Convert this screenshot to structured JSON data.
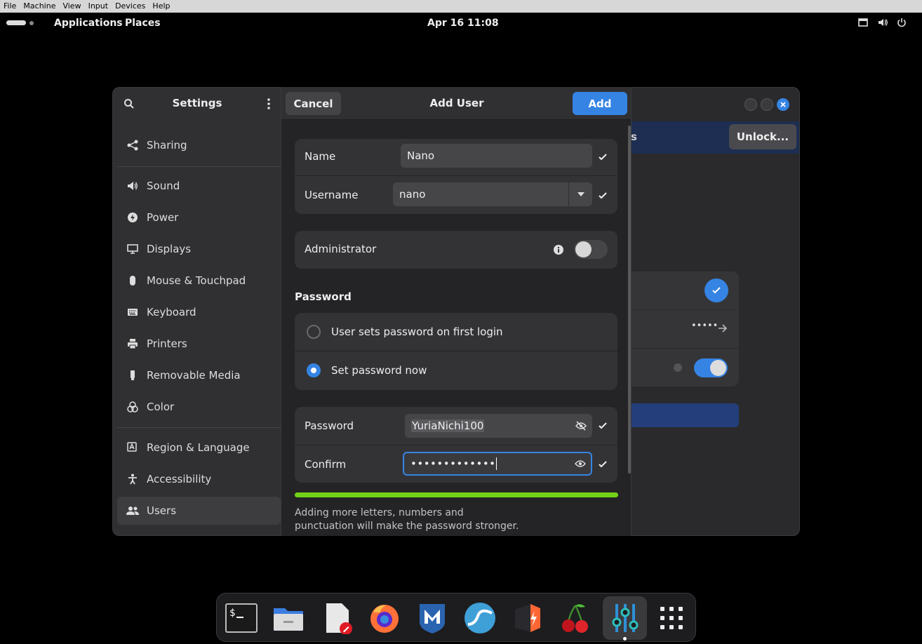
{
  "vm_menu": [
    "File",
    "Machine",
    "View",
    "Input",
    "Devices",
    "Help"
  ],
  "topbar": {
    "applications": "Applications",
    "places": "Places",
    "clock": "Apr 16  11:08"
  },
  "settings": {
    "title": "Settings",
    "unlock_label": "Unlock...",
    "partial_text": "s",
    "masked_dots": "•••••",
    "sidebar": [
      {
        "label": "Sharing",
        "icon": "share-icon"
      },
      {
        "label": "Sound",
        "icon": "speaker-icon"
      },
      {
        "label": "Power",
        "icon": "power-icon"
      },
      {
        "label": "Displays",
        "icon": "display-icon"
      },
      {
        "label": "Mouse & Touchpad",
        "icon": "mouse-icon"
      },
      {
        "label": "Keyboard",
        "icon": "keyboard-icon"
      },
      {
        "label": "Printers",
        "icon": "printer-icon"
      },
      {
        "label": "Removable Media",
        "icon": "usb-icon"
      },
      {
        "label": "Color",
        "icon": "color-icon"
      },
      {
        "label": "Region & Language",
        "icon": "region-icon"
      },
      {
        "label": "Accessibility",
        "icon": "accessibility-icon"
      },
      {
        "label": "Users",
        "icon": "users-icon"
      }
    ]
  },
  "dialog": {
    "title": "Add User",
    "cancel": "Cancel",
    "add": "Add",
    "name_label": "Name",
    "name_value": "Nano",
    "username_label": "Username",
    "username_value": "nano",
    "admin_label": "Administrator",
    "password_section": "Password",
    "option_first_login": "User sets password on first login",
    "option_set_now": "Set password now",
    "password_label": "Password",
    "password_value": "YuriaNichi100",
    "confirm_label": "Confirm",
    "confirm_value": "•••••••••••••",
    "strength_percent": 100,
    "hint": "Adding more letters, numbers and punctuation will make the password stronger."
  },
  "dock": [
    "terminal",
    "files",
    "text-editor",
    "firefox",
    "metasploit",
    "wireshark",
    "burp-suite",
    "cherrytree",
    "settings",
    "app-grid"
  ],
  "colors": {
    "accent": "#3584e4",
    "strength": "#73d216"
  }
}
